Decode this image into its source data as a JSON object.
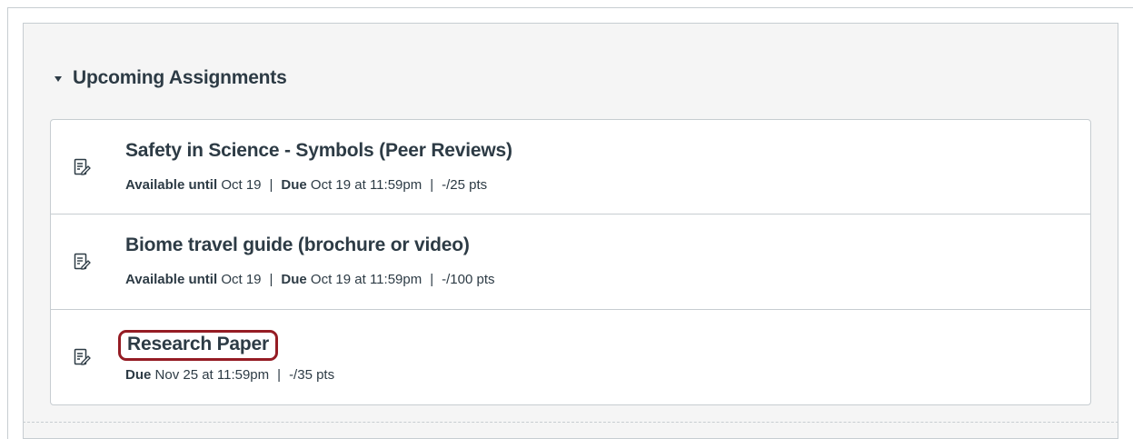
{
  "group": {
    "title": "Upcoming Assignments",
    "toggle_icon": "caret-down-icon"
  },
  "assignments": [
    {
      "title": "Safety in Science - Symbols (Peer Reviews)",
      "icon": "assignment-icon",
      "available_label": "Available until",
      "available_value": "Oct 19",
      "due_label": "Due",
      "due_value": "Oct 19 at 11:59pm",
      "points": "-/25 pts"
    },
    {
      "title": "Biome travel guide (brochure or video)",
      "icon": "assignment-icon",
      "available_label": "Available until",
      "available_value": "Oct 19",
      "due_label": "Due",
      "due_value": "Oct 19 at 11:59pm",
      "points": "-/100 pts"
    },
    {
      "title": "Research Paper",
      "icon": "assignment-icon",
      "due_label": "Due",
      "due_value": "Nov 25 at 11:59pm",
      "points": "-/35 pts",
      "highlighted": true
    }
  ],
  "colors": {
    "text": "#2d3b45",
    "highlight_border": "#951c24",
    "panel_background": "#f5f5f5",
    "border": "#c7cdd1"
  }
}
